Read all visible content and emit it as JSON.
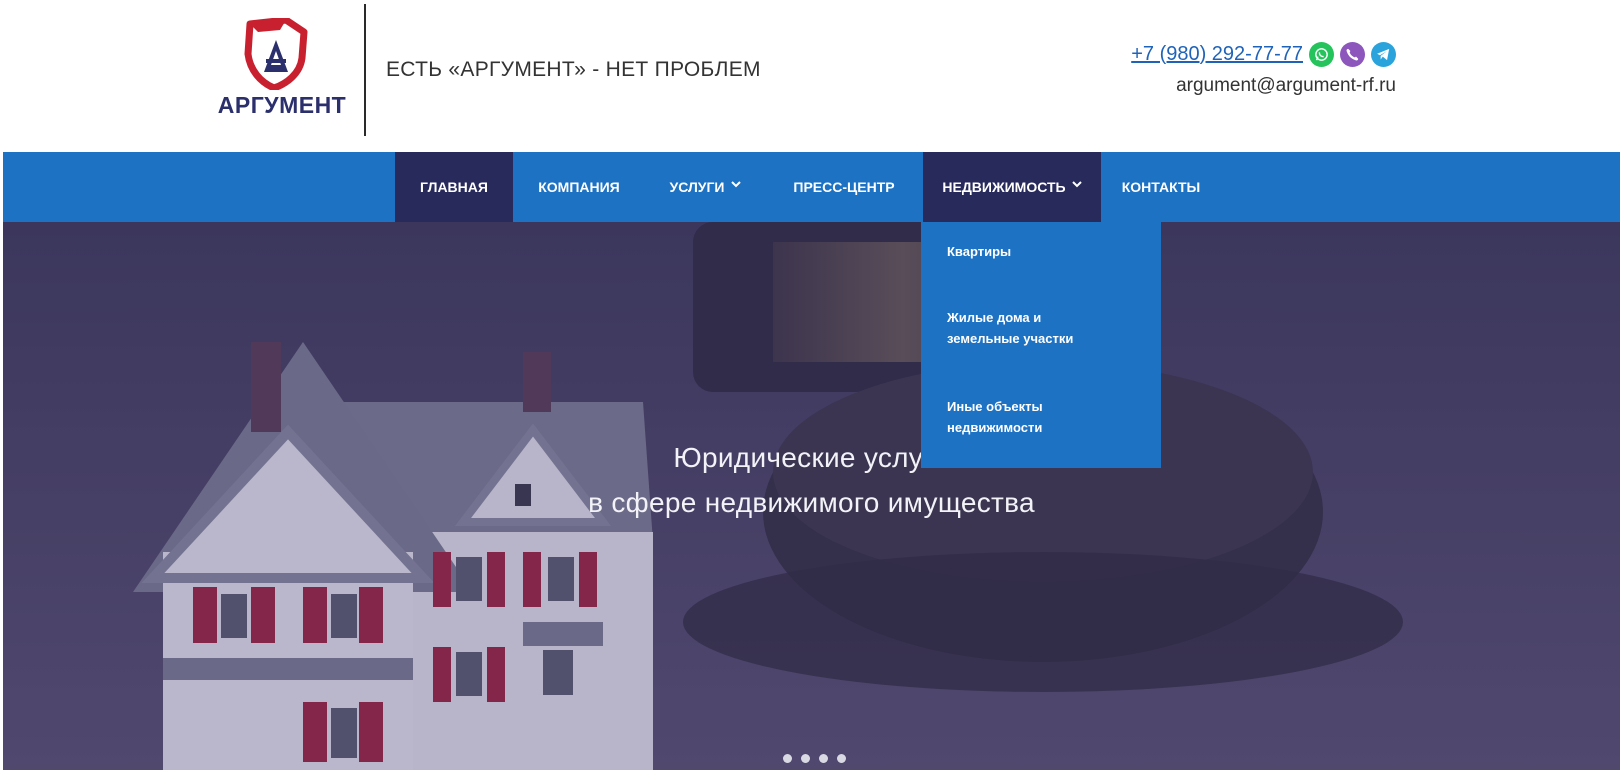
{
  "header": {
    "logo_text": "АРГУМЕНТ",
    "tagline": "ЕСТЬ «АРГУМЕНТ» - НЕТ ПРОБЛЕМ",
    "phone": "+7 (980) 292-77-77",
    "email": "argument@argument-rf.ru",
    "messengers": [
      {
        "icon": "whatsapp-icon",
        "color": "#25c35b"
      },
      {
        "icon": "viber-icon",
        "color": "#8c56bd"
      },
      {
        "icon": "telegram-icon",
        "color": "#2aa3dc"
      }
    ]
  },
  "nav": {
    "items": [
      {
        "label": "ГЛАВНАЯ",
        "active": true
      },
      {
        "label": "КОМПАНИЯ"
      },
      {
        "label": "УСЛУГИ",
        "has_submenu": true
      },
      {
        "label": "ПРЕСС-ЦЕНТР"
      },
      {
        "label": "НЕДВИЖИМОСТЬ",
        "has_submenu": true,
        "open": true
      },
      {
        "label": "КОНТАКТЫ"
      }
    ]
  },
  "dropdown": {
    "items": [
      {
        "line1": "Квартиры"
      },
      {
        "line1": "Жилые дома и",
        "line2": "земельные участки"
      },
      {
        "line1": "Иные объекты",
        "line2": "недвижимости"
      }
    ]
  },
  "hero": {
    "caption_line1": "Юридические услуги",
    "caption_line2": "в сфере недвижимого имущества",
    "slide_count": 4,
    "active_slide": 2
  },
  "colors": {
    "nav_bg": "#1d72c4",
    "nav_active_bg": "#282a5c",
    "logo_red": "#c8202e",
    "logo_navy": "#2b2f6b",
    "phone_link": "#1f63b8"
  }
}
